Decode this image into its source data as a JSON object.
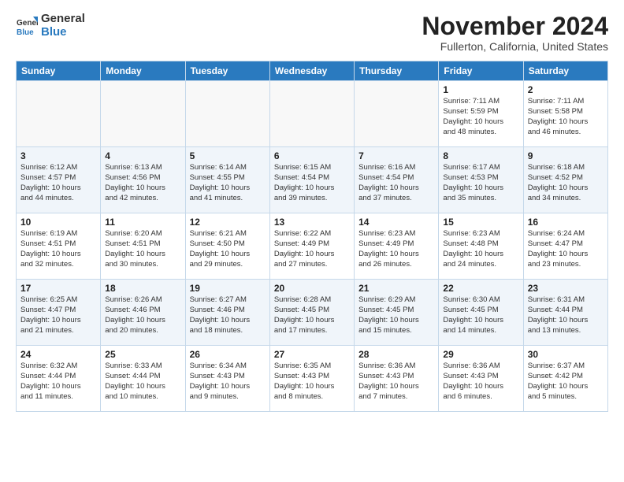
{
  "logo": {
    "line1": "General",
    "line2": "Blue"
  },
  "title": "November 2024",
  "subtitle": "Fullerton, California, United States",
  "days_of_week": [
    "Sunday",
    "Monday",
    "Tuesday",
    "Wednesday",
    "Thursday",
    "Friday",
    "Saturday"
  ],
  "weeks": [
    [
      {
        "day": "",
        "info": ""
      },
      {
        "day": "",
        "info": ""
      },
      {
        "day": "",
        "info": ""
      },
      {
        "day": "",
        "info": ""
      },
      {
        "day": "",
        "info": ""
      },
      {
        "day": "1",
        "info": "Sunrise: 7:11 AM\nSunset: 5:59 PM\nDaylight: 10 hours\nand 48 minutes."
      },
      {
        "day": "2",
        "info": "Sunrise: 7:11 AM\nSunset: 5:58 PM\nDaylight: 10 hours\nand 46 minutes."
      }
    ],
    [
      {
        "day": "3",
        "info": "Sunrise: 6:12 AM\nSunset: 4:57 PM\nDaylight: 10 hours\nand 44 minutes."
      },
      {
        "day": "4",
        "info": "Sunrise: 6:13 AM\nSunset: 4:56 PM\nDaylight: 10 hours\nand 42 minutes."
      },
      {
        "day": "5",
        "info": "Sunrise: 6:14 AM\nSunset: 4:55 PM\nDaylight: 10 hours\nand 41 minutes."
      },
      {
        "day": "6",
        "info": "Sunrise: 6:15 AM\nSunset: 4:54 PM\nDaylight: 10 hours\nand 39 minutes."
      },
      {
        "day": "7",
        "info": "Sunrise: 6:16 AM\nSunset: 4:54 PM\nDaylight: 10 hours\nand 37 minutes."
      },
      {
        "day": "8",
        "info": "Sunrise: 6:17 AM\nSunset: 4:53 PM\nDaylight: 10 hours\nand 35 minutes."
      },
      {
        "day": "9",
        "info": "Sunrise: 6:18 AM\nSunset: 4:52 PM\nDaylight: 10 hours\nand 34 minutes."
      }
    ],
    [
      {
        "day": "10",
        "info": "Sunrise: 6:19 AM\nSunset: 4:51 PM\nDaylight: 10 hours\nand 32 minutes."
      },
      {
        "day": "11",
        "info": "Sunrise: 6:20 AM\nSunset: 4:51 PM\nDaylight: 10 hours\nand 30 minutes."
      },
      {
        "day": "12",
        "info": "Sunrise: 6:21 AM\nSunset: 4:50 PM\nDaylight: 10 hours\nand 29 minutes."
      },
      {
        "day": "13",
        "info": "Sunrise: 6:22 AM\nSunset: 4:49 PM\nDaylight: 10 hours\nand 27 minutes."
      },
      {
        "day": "14",
        "info": "Sunrise: 6:23 AM\nSunset: 4:49 PM\nDaylight: 10 hours\nand 26 minutes."
      },
      {
        "day": "15",
        "info": "Sunrise: 6:23 AM\nSunset: 4:48 PM\nDaylight: 10 hours\nand 24 minutes."
      },
      {
        "day": "16",
        "info": "Sunrise: 6:24 AM\nSunset: 4:47 PM\nDaylight: 10 hours\nand 23 minutes."
      }
    ],
    [
      {
        "day": "17",
        "info": "Sunrise: 6:25 AM\nSunset: 4:47 PM\nDaylight: 10 hours\nand 21 minutes."
      },
      {
        "day": "18",
        "info": "Sunrise: 6:26 AM\nSunset: 4:46 PM\nDaylight: 10 hours\nand 20 minutes."
      },
      {
        "day": "19",
        "info": "Sunrise: 6:27 AM\nSunset: 4:46 PM\nDaylight: 10 hours\nand 18 minutes."
      },
      {
        "day": "20",
        "info": "Sunrise: 6:28 AM\nSunset: 4:45 PM\nDaylight: 10 hours\nand 17 minutes."
      },
      {
        "day": "21",
        "info": "Sunrise: 6:29 AM\nSunset: 4:45 PM\nDaylight: 10 hours\nand 15 minutes."
      },
      {
        "day": "22",
        "info": "Sunrise: 6:30 AM\nSunset: 4:45 PM\nDaylight: 10 hours\nand 14 minutes."
      },
      {
        "day": "23",
        "info": "Sunrise: 6:31 AM\nSunset: 4:44 PM\nDaylight: 10 hours\nand 13 minutes."
      }
    ],
    [
      {
        "day": "24",
        "info": "Sunrise: 6:32 AM\nSunset: 4:44 PM\nDaylight: 10 hours\nand 11 minutes."
      },
      {
        "day": "25",
        "info": "Sunrise: 6:33 AM\nSunset: 4:44 PM\nDaylight: 10 hours\nand 10 minutes."
      },
      {
        "day": "26",
        "info": "Sunrise: 6:34 AM\nSunset: 4:43 PM\nDaylight: 10 hours\nand 9 minutes."
      },
      {
        "day": "27",
        "info": "Sunrise: 6:35 AM\nSunset: 4:43 PM\nDaylight: 10 hours\nand 8 minutes."
      },
      {
        "day": "28",
        "info": "Sunrise: 6:36 AM\nSunset: 4:43 PM\nDaylight: 10 hours\nand 7 minutes."
      },
      {
        "day": "29",
        "info": "Sunrise: 6:36 AM\nSunset: 4:43 PM\nDaylight: 10 hours\nand 6 minutes."
      },
      {
        "day": "30",
        "info": "Sunrise: 6:37 AM\nSunset: 4:42 PM\nDaylight: 10 hours\nand 5 minutes."
      }
    ]
  ]
}
